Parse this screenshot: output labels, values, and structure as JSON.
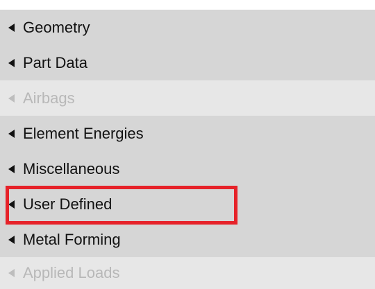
{
  "menu": {
    "items": [
      {
        "label": "Geometry",
        "enabled": true
      },
      {
        "label": "Part Data",
        "enabled": true
      },
      {
        "label": "Airbags",
        "enabled": false
      },
      {
        "label": "Element Energies",
        "enabled": true
      },
      {
        "label": "Miscellaneous",
        "enabled": true
      },
      {
        "label": "User Defined",
        "enabled": true,
        "highlighted": true
      },
      {
        "label": "Metal Forming",
        "enabled": true
      },
      {
        "label": "Applied Loads",
        "enabled": false
      }
    ]
  },
  "highlight": {
    "color": "#e62229",
    "target": "User Defined"
  },
  "colors": {
    "row_background": "#d6d6d6",
    "disabled_row_background": "#e7e7e7",
    "disabled_text": "#b8b8b8",
    "text": "#111111"
  }
}
